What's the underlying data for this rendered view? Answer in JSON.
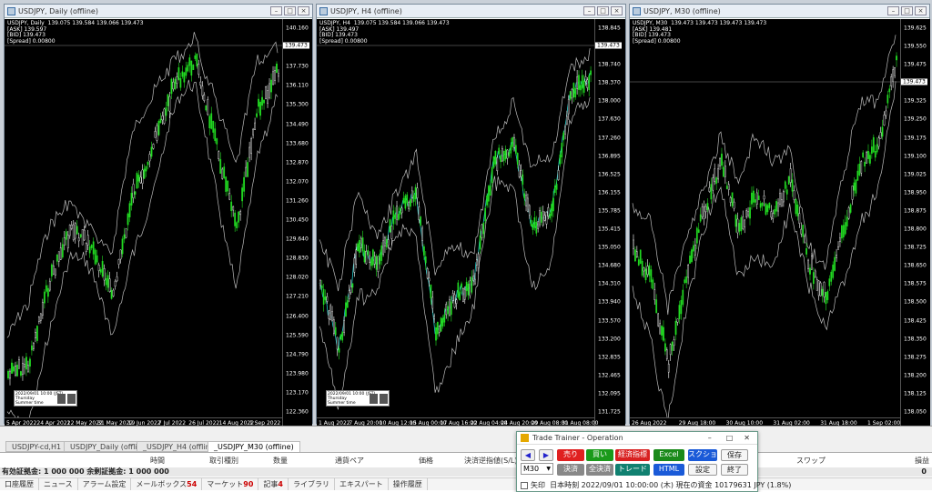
{
  "charts": [
    {
      "title": "USDJPY, Daily (offline)",
      "info": "USDJPY, Daily  139.075 139.584 139.066 139.473\n[ASK] 139.597\n[BID] 139.473\n[Spread] 0.00800",
      "current_price": "139.473",
      "yticks": [
        "140.160",
        "138.540",
        "137.730",
        "136.110",
        "135.300",
        "134.490",
        "133.680",
        "132.870",
        "132.070",
        "131.260",
        "130.450",
        "129.640",
        "128.830",
        "128.020",
        "127.210",
        "126.400",
        "125.590",
        "124.790",
        "123.980",
        "123.170",
        "122.360"
      ],
      "xticks": [
        "5 Apr 2022",
        "24 Apr 2022",
        "12 May 2022",
        "31 May 2022",
        "19 Jun 2022",
        "7 Jul 2022",
        "26 Jul 2022",
        "14 Aug 2022",
        "1 Sep 2022"
      ],
      "mini": {
        "time": "2022/09/01 10:00 (JST)",
        "day": "Thursday",
        "label": "Summer time"
      }
    },
    {
      "title": "USDJPY, H4 (offline)",
      "info": "USDJPY, H4  139.075 139.584 139.066 139.473\n[ASK] 139.497\n[BID] 139.473\n[Spread] 0.00800",
      "current_price": "139.473",
      "yticks": [
        "138.845",
        "139.110",
        "138.740",
        "138.370",
        "138.000",
        "137.630",
        "137.260",
        "136.895",
        "136.525",
        "136.155",
        "135.785",
        "135.415",
        "135.050",
        "134.680",
        "134.310",
        "133.940",
        "133.570",
        "133.200",
        "132.835",
        "132.465",
        "132.095",
        "131.725"
      ],
      "xticks": [
        "1 Aug 2022",
        "7 Aug 20:00",
        "10 Aug 12:00",
        "15 Aug 00:00",
        "17 Aug 16:00",
        "22 Aug 04:00",
        "24 Aug 20:00",
        "29 Aug 08:00",
        "31 Aug 08:00"
      ],
      "mini": {
        "time": "2022/09/01 10:00 (JST)",
        "day": "Thursday",
        "label": "Summer time"
      }
    },
    {
      "title": "USDJPY, M30 (offline)",
      "info": "USDJPY, M30  139.473 139.473 139.473 139.473\n[ASK] 139.481\n[BID] 139.473\n[Spread] 0.00800",
      "current_price": "139.473",
      "yticks": [
        "139.625",
        "139.550",
        "139.475",
        "139.400",
        "139.325",
        "139.250",
        "139.175",
        "139.100",
        "139.025",
        "138.950",
        "138.875",
        "138.800",
        "138.725",
        "138.650",
        "138.575",
        "138.500",
        "138.425",
        "138.350",
        "138.275",
        "138.200",
        "138.125",
        "138.050"
      ],
      "xticks": [
        "26 Aug 2022",
        "29 Aug 18:00",
        "30 Aug 10:00",
        "31 Aug 02:00",
        "31 Aug 18:00",
        "1 Sep 02:00"
      ],
      "mini": null
    }
  ],
  "tabs": [
    "USDJPY-cd,H1",
    "USDJPY_Daily (offline)",
    "_USDJPY_H4 (offline)",
    "_USDJPY_M30 (offline)"
  ],
  "terminal": {
    "columns": [
      "時間",
      "取引種別",
      "数量",
      "通貨ペア",
      "価格",
      "決済逆指値(S/L)",
      "スワップ",
      "損益"
    ],
    "balance": "有効証拠金: 1 000 000  余剰証拠金: 1 000 000",
    "balance_value": "0",
    "tabs": [
      {
        "label": "口座履歴",
        "count": ""
      },
      {
        "label": "ニュース",
        "count": ""
      },
      {
        "label": "アラーム設定",
        "count": ""
      },
      {
        "label": "メールボックス",
        "count": "54"
      },
      {
        "label": "マーケット",
        "count": "90"
      },
      {
        "label": "記事",
        "count": "4"
      },
      {
        "label": "ライブラリ",
        "count": ""
      },
      {
        "label": "エキスパート",
        "count": ""
      },
      {
        "label": "操作履歴",
        "count": ""
      }
    ]
  },
  "trainer": {
    "title": "Trade Trainer - Operation",
    "timeframe": "M30",
    "buttons": {
      "sell": "売り",
      "buy": "買い",
      "indicators": "経済指標",
      "excel": "Excel",
      "screenshot": "スクショ",
      "save": "保存",
      "close": "決済",
      "close_all": "全決済",
      "trade": "トレード",
      "html": "HTML",
      "settings": "設定",
      "quit": "終了"
    },
    "status_label": "矢印",
    "status": "日本時刻 2022/09/01 10:00:00 (木)   現在の資金 10179631 JPY (1.8%)"
  },
  "colors": {
    "bull": "#22dd22",
    "bear": "#ffffff",
    "band": "#bbbbbb",
    "ma_cyan": "#22cccc"
  }
}
